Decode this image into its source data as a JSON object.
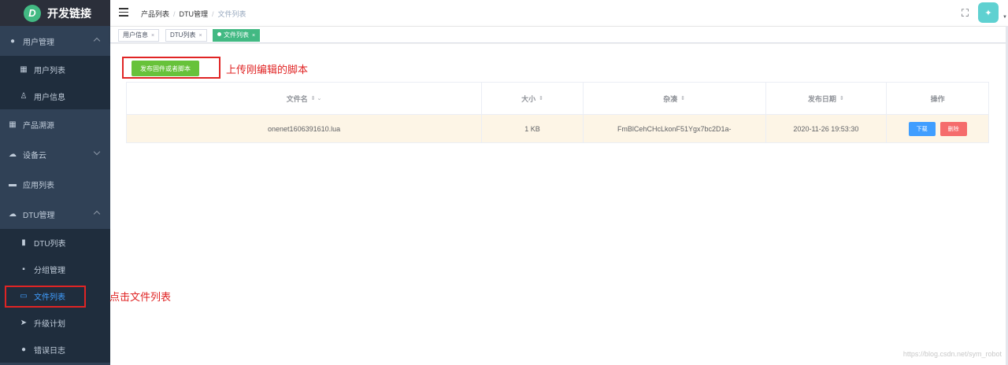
{
  "brand": {
    "logo_letter": "D",
    "title": "开发链接",
    "logo_color": "#42b983"
  },
  "sidebar": {
    "items": [
      {
        "label": "用户管理",
        "icon": "user-icon"
      },
      {
        "label": "用户列表",
        "icon": "table-icon"
      },
      {
        "label": "用户信息",
        "icon": "person-icon"
      },
      {
        "label": "产品溯源",
        "icon": "table-icon"
      },
      {
        "label": "设备云",
        "icon": "cloud-icon"
      },
      {
        "label": "应用列表",
        "icon": "monitor-icon"
      },
      {
        "label": "DTU管理",
        "icon": "cloud-icon"
      },
      {
        "label": "DTU列表",
        "icon": "bar-chart-icon"
      },
      {
        "label": "分组管理",
        "icon": "grid-icon"
      },
      {
        "label": "文件列表",
        "icon": "folder-icon"
      },
      {
        "label": "升级计划",
        "icon": "send-icon"
      },
      {
        "label": "错误日志",
        "icon": "alert-icon"
      }
    ]
  },
  "breadcrumb": [
    "产品列表",
    "DTU管理",
    "文件列表"
  ],
  "tags": [
    "用户信息",
    "DTU列表",
    "文件列表"
  ],
  "main": {
    "upload_button": "发布固件或者脚本",
    "table": {
      "headers": [
        "文件名",
        "大小",
        "杂凑",
        "发布日期",
        "操作"
      ],
      "rows": [
        {
          "name": "onenet1606391610.lua",
          "size": "1 KB",
          "hash": "FmBlCehCHcLkonF51Ygx7bc2D1a-",
          "date": "2020-11-26 19:53:30"
        }
      ],
      "download_label": "下载",
      "delete_label": "删除"
    }
  },
  "annotations": {
    "upload_note": "上传刚编辑的脚本",
    "menu_note": "点击文件列表"
  },
  "watermark": "https://blog.csdn.net/sym_robot",
  "colors": {
    "sidebar": "#304156",
    "accent_green": "#67c23a",
    "primary": "#409eff",
    "danger": "#f56c6c",
    "annotation_red": "#e02424"
  }
}
